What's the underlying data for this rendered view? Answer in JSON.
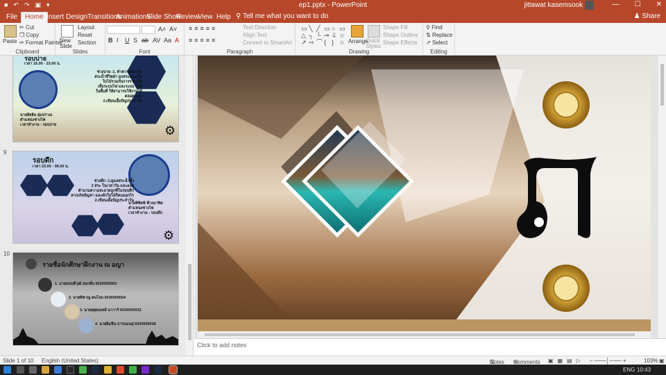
{
  "titlebar": {
    "title": "ep1.pptx  -  PowerPoint",
    "user": "jittawat kasemsook",
    "qat": [
      "■",
      "↶",
      "↷",
      "▣",
      "▾"
    ],
    "controls": [
      "―",
      "☐",
      "✕"
    ]
  },
  "tabs": [
    {
      "label": "File"
    },
    {
      "label": "Home"
    },
    {
      "label": "Insert"
    },
    {
      "label": "Design"
    },
    {
      "label": "Transitions"
    },
    {
      "label": "Animations"
    },
    {
      "label": "Slide Show"
    },
    {
      "label": "Review"
    },
    {
      "label": "View"
    },
    {
      "label": "Help"
    }
  ],
  "tell_me": "Tell me what you want to do",
  "share": "Share",
  "ribbon": {
    "clipboard": {
      "label": "Clipboard",
      "paste": "Paste",
      "cut": "Cut",
      "copy": "Copy",
      "format_painter": "Format Painter"
    },
    "slides": {
      "label": "Slides",
      "new_slide": "New Slide",
      "layout": "Layout",
      "reset": "Reset",
      "section": "Section"
    },
    "font": {
      "label": "Font",
      "buttons": [
        "B",
        "I",
        "U",
        "S",
        "ab",
        "AV",
        "Aa",
        "A"
      ]
    },
    "paragraph": {
      "label": "Paragraph",
      "text_direction": "Text Direction",
      "align_text": "Align Text",
      "convert": "Convert to SmartArt"
    },
    "drawing": {
      "label": "Drawing",
      "arrange": "Arrange",
      "quick_styles": "Quick Styles",
      "shape_fill": "Shape Fill",
      "shape_outline": "Shape Outline",
      "shape_effects": "Shape Effects",
      "shape_glyphs": [
        "▭",
        "╲",
        "╱",
        "▭",
        "○",
        "▭",
        "△",
        "┐",
        "└",
        "⇒",
        "⇩",
        "☆",
        "↗",
        "⇨",
        "⌒",
        "{",
        "}",
        "☆"
      ]
    },
    "editing": {
      "label": "Editing",
      "find": "Find",
      "replace": "Replace",
      "select": "Select"
    }
  },
  "thumbnails": {
    "slide8": {
      "title": "รอบบ่าย",
      "time": "เวลา 16.00 - 23.00 น.",
      "body": [
        "ช่วงบ่าย :1. ทำความสะอาด",
        "สระน้ำชีวิตฝ่า ถูกสระและเก็บ",
        "ใบไม้รวมกับการรวจเช็ค",
        "เสื่อระบบไฟ และระบบ โซลี",
        "ในพื้นที่ ให้สามารถใช้งานได้",
        "ตลอดเวลา",
        "2.เขียนเอื้อปัญประจำวัน"
      ],
      "footer": [
        "นายยิยยิม ยุ่มปราณ",
        "ตำแหน่งช่างไฟ",
        "เวลาทำงาน : รอบบ่าย"
      ]
    },
    "slide9": {
      "num": "9",
      "title": "รอบดึก",
      "time": "เวลา 23.00 - 08.00 น.",
      "body": [
        "ช่วงดึก :1.ดูแลสระน้ำทั้ง",
        "2 สระ ในเวลาวัน และออย",
        "ตำนวนความสะอาดถูกที่ในรอบดึก",
        "หากเกิดปัญหา และดักใบไม้ก็ตนออกไร",
        "2.เขียนเอื้อปัญประจำวัน"
      ],
      "footer": [
        "นายพิชิตพิ ฟ้างมาทิด",
        "ตำแหน่งช่างไฟ",
        "เวลาทำงาน : รอบดึก"
      ]
    },
    "slide10": {
      "num": "10",
      "title": "รายชื่อนักศึกษาฝึกงาน ณ อญา",
      "people": [
        "1. นายธนบดีวุฒิ ลอกลั่น  6030500003",
        "2. นายพิชาญ คนโจม  6030500004",
        "3. นายพุทุยณทมิ นาวาริ  6030500032",
        "4. นายยิมชิน ธารแมนสุ  6030500036"
      ]
    }
  },
  "notes_placeholder": "Click to add notes",
  "status": {
    "slide_of": "Slide 1 of 10",
    "language": "English (United States)",
    "notes": "Notes",
    "comments": "Comments",
    "zoom": "103%"
  },
  "taskbar": {
    "lang": "ENG",
    "time": "10:43"
  }
}
